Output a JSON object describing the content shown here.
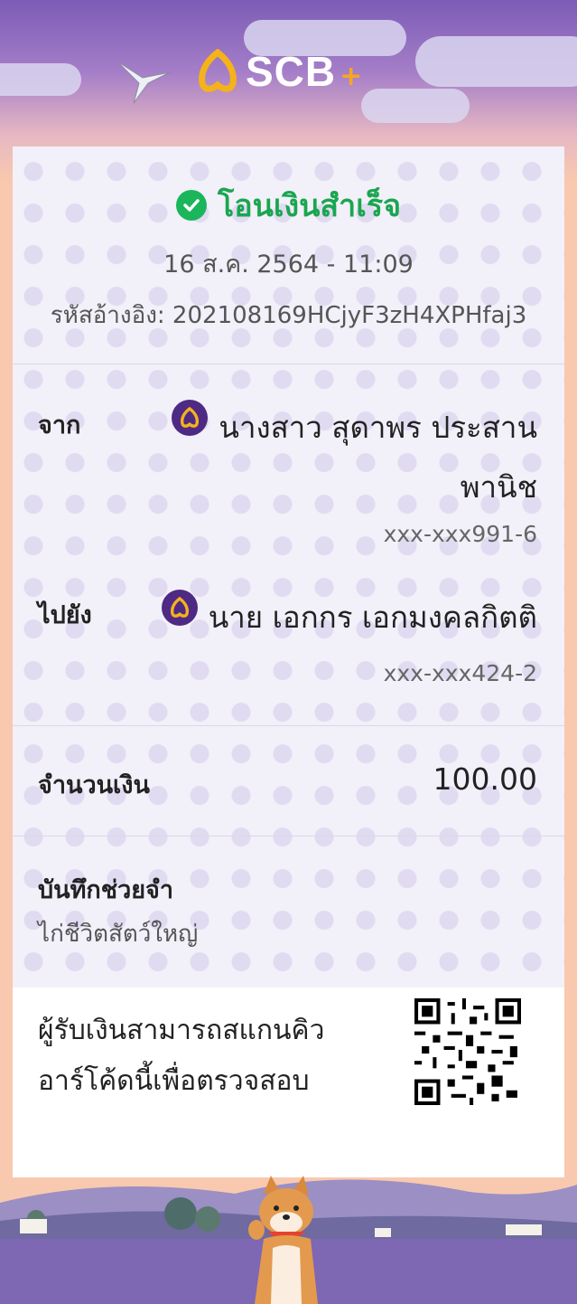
{
  "header": {
    "brand": "SCB",
    "plus": "+"
  },
  "status": {
    "title": "โอนเงินสำเร็จ",
    "icon": "check-circle-icon"
  },
  "datetime": "16 ส.ค. 2564 - 11:09",
  "reference": "รหัสอ้างอิง: 202108169HCjyF3zH4XPHfaj3",
  "from": {
    "label": "จาก",
    "name_line1": "นางสาว สุดาพร ประสาน",
    "name_line2": "พานิช",
    "account": "xxx-xxx991-6",
    "icon": "scb-bank-icon"
  },
  "to": {
    "label": "ไปยัง",
    "name": "นาย เอกกร เอกมงคลกิตติ",
    "account": "xxx-xxx424-2",
    "icon": "scb-bank-icon"
  },
  "amount": {
    "label": "จำนวนเงิน",
    "value": "100.00"
  },
  "memo": {
    "label": "บันทึกช่วยจำ",
    "value": "ไก่ชีวิตสัตว์ใหญ่"
  },
  "qr": {
    "text_line1": "ผู้รับเงินสามารถสแกนคิว",
    "text_line2": "อาร์โค้ดนี้เพื่อตรวจสอบ"
  },
  "colors": {
    "success": "#1aa64f",
    "scb_purple": "#4e2a84",
    "background": "#f8c9ae"
  }
}
